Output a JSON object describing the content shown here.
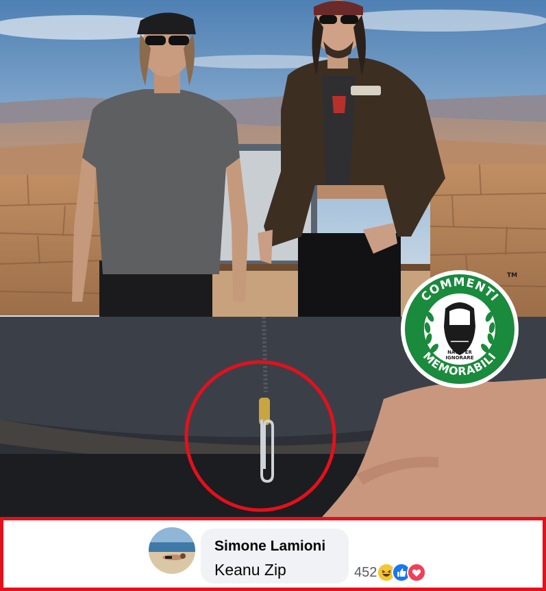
{
  "image": {
    "top_photo_icon": "two-men-overlook-photo",
    "zoom_photo_icon": "zipper-paperclip-closeup",
    "highlight_color": "#e4101b"
  },
  "watermark": {
    "icon": "commenti-memorabili-logo",
    "text_top": "COMMENTI",
    "text_bottom": "MEMORABILI",
    "tagline_line1": "NATI PER",
    "tagline_line2": "IGNORARE",
    "trademark": "TM",
    "color": "#1a8a3c"
  },
  "comment": {
    "author": "Simone Lamioni",
    "text": "Keanu Zip",
    "avatar_icon": "beach-avatar",
    "reaction_count": "452",
    "reactions": [
      "haha-icon",
      "like-icon",
      "love-icon"
    ],
    "border_color": "#e4101b"
  }
}
